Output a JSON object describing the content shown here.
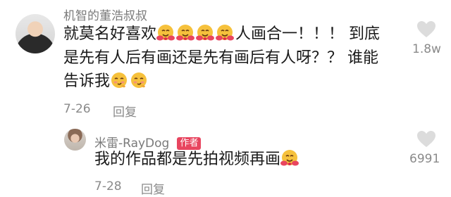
{
  "comment": {
    "username": "机智的董浩叔叔",
    "line1_text_a": "就莫名好喜欢",
    "line1_text_b": "人画合一！！！ 到底",
    "line2": "是先有人后有画还是先有画后有人呀？？ 谁能",
    "line3": "告诉我",
    "date": "7-26",
    "reply_label": "回复",
    "like_count": "1.8w"
  },
  "reply": {
    "username": "米雷-RayDog",
    "author_tag": "作者",
    "text": "我的作品都是先拍视频再画",
    "date": "7-28",
    "reply_label": "回复",
    "like_count": "6991"
  },
  "icons": {
    "hug_emoji": "hugging-face-emoji",
    "shy_emoji": "smirk-face-emoji",
    "heart": "heart-outline-icon"
  },
  "colors": {
    "author_tag_bg": "#e8455f",
    "meta_gray": "#8a8a8a",
    "emoji_yellow": "#f6c13c"
  }
}
